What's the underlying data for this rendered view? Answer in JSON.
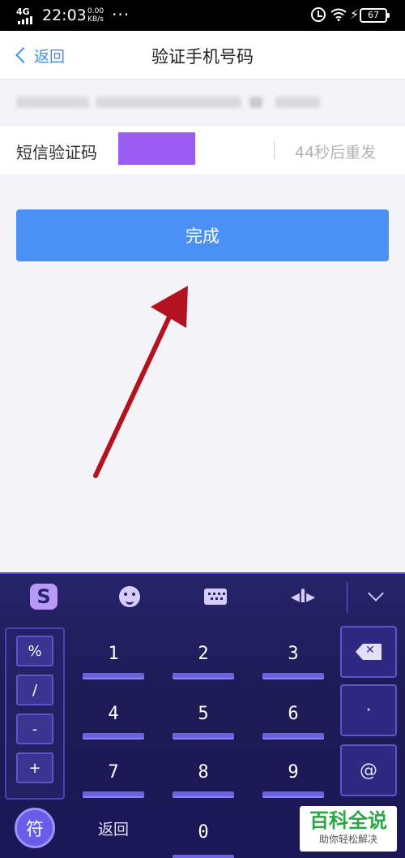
{
  "status_bar": {
    "network": "4G",
    "time": "22:03",
    "speed_value": "0.00",
    "speed_unit": "KB/s",
    "more": "···",
    "battery": "67"
  },
  "nav": {
    "back_label": "返回",
    "title": "验证手机号码"
  },
  "form": {
    "code_label": "短信验证码",
    "resend_text": "44秒后重发"
  },
  "primary_button": {
    "label": "完成"
  },
  "colors": {
    "accent": "#4a90f5",
    "code_input_fill": "#9b5cf3",
    "annotation_arrow": "#b3121f"
  },
  "keyboard": {
    "toolbar_icons": [
      "sogou-logo-icon",
      "emoji-icon",
      "keyboard-icon",
      "cursor-move-icon",
      "chevron-down-icon"
    ],
    "logo_letter": "S",
    "cursor_glyph": "◂I▸",
    "symbols": [
      "%",
      "/",
      "-",
      "+"
    ],
    "numbers": [
      "1",
      "2",
      "3",
      "4",
      "5",
      "6",
      "7",
      "8",
      "9",
      "0"
    ],
    "side_keys": {
      "dot": "·",
      "at": "@"
    },
    "fu_label": "符",
    "back_label": "返回"
  },
  "watermark": {
    "title": "百科全说",
    "subtitle": "助你轻松解决"
  }
}
